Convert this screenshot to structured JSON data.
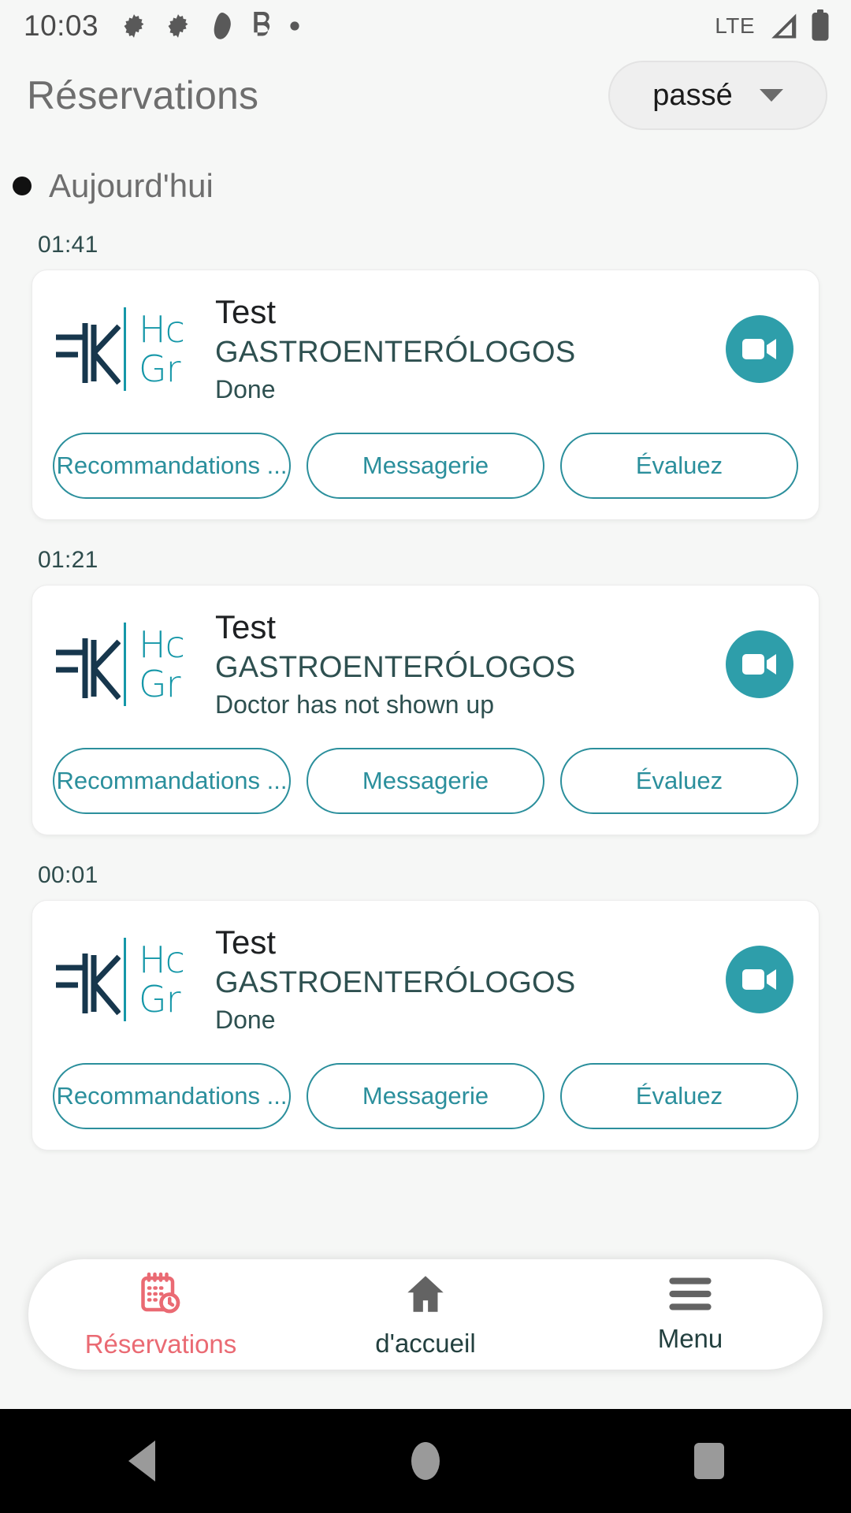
{
  "status_bar": {
    "time": "10:03",
    "left_icons": [
      "gear-icon",
      "gear-icon",
      "blob-icon",
      "b-letter-icon",
      "dot-icon"
    ],
    "network": "LTE",
    "right_icons": [
      "signal-icon",
      "battery-icon"
    ]
  },
  "header": {
    "title": "Réservations",
    "filter": {
      "value": "passé",
      "icon": "chevron-down-icon"
    }
  },
  "section": {
    "label": "Aujourd'hui",
    "bullet": "•"
  },
  "logo": {
    "mark": "=IK",
    "line1": "Hc",
    "line2": "Gr"
  },
  "colors": {
    "teal": "#2b8f9c",
    "teal_logo": "#1597a8",
    "call_button": "#2e9eaa",
    "accent_pink": "#ea6a73",
    "slate": "#2e5050",
    "background": "#f6f7f6"
  },
  "appointments": [
    {
      "time": "01:41",
      "name": "Test",
      "specialty": "GASTROENTERÓLOGOS",
      "status": "Done",
      "call_icon": "video-camera-icon",
      "actions": [
        "Recommandations ...",
        "Messagerie",
        "Évaluez"
      ]
    },
    {
      "time": "01:21",
      "name": "Test",
      "specialty": "GASTROENTERÓLOGOS",
      "status": "Doctor has not shown up",
      "call_icon": "video-camera-icon",
      "actions": [
        "Recommandations ...",
        "Messagerie",
        "Évaluez"
      ]
    },
    {
      "time": "00:01",
      "name": "Test",
      "specialty": "GASTROENTERÓLOGOS",
      "status": "Done",
      "call_icon": "video-camera-icon",
      "actions": [
        "Recommandations ...",
        "Messagerie",
        "Évaluez"
      ]
    }
  ],
  "bottom_nav": [
    {
      "label": "Réservations",
      "icon": "calendar-clock-icon",
      "active": true
    },
    {
      "label": "d'accueil",
      "icon": "home-icon",
      "active": false
    },
    {
      "label": "Menu",
      "icon": "hamburger-menu-icon",
      "active": false
    }
  ],
  "android_nav": [
    {
      "icon": "back-triangle-icon"
    },
    {
      "icon": "home-circle-icon"
    },
    {
      "icon": "recents-square-icon"
    }
  ]
}
